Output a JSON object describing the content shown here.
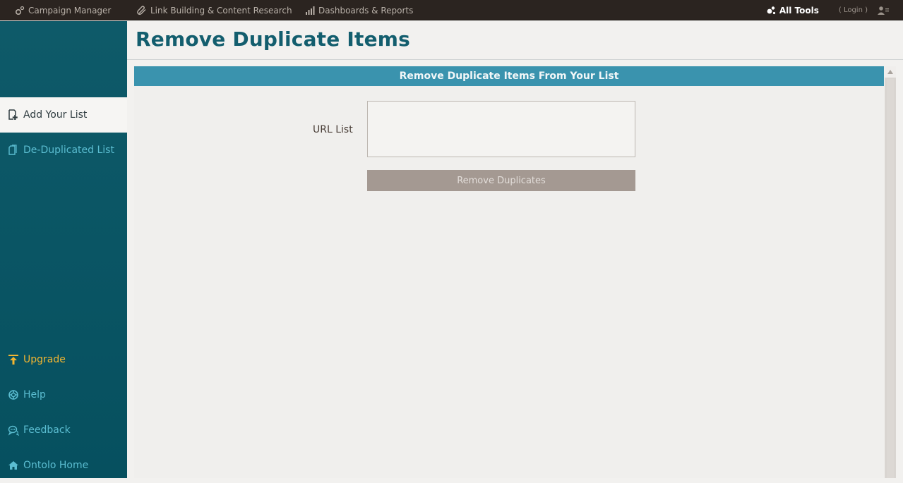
{
  "topnav": {
    "items": [
      {
        "label": "Campaign Manager",
        "icon": "gear-icon"
      },
      {
        "label": "Link Building & Content Research",
        "icon": "paperclip-icon"
      },
      {
        "label": "Dashboards & Reports",
        "icon": "bar-chart-icon"
      }
    ],
    "all_tools": "All Tools",
    "login": "( Login )"
  },
  "sidebar": {
    "items": [
      {
        "label": "Add Your List",
        "icon": "add-document-icon",
        "active": true
      },
      {
        "label": "De-Duplicated List",
        "icon": "document-icon"
      },
      {
        "label": "Upgrade",
        "icon": "upload-arrow-icon"
      },
      {
        "label": "Help",
        "icon": "lifebuoy-icon"
      },
      {
        "label": "Feedback",
        "icon": "chat-bubbles-icon"
      },
      {
        "label": "Ontolo Home",
        "icon": "home-icon"
      }
    ]
  },
  "main": {
    "title": "Remove Duplicate Items",
    "panel_header": "Remove Duplicate Items From Your List",
    "url_list_label": "URL List",
    "url_list_value": "",
    "remove_button": "Remove Duplicates"
  },
  "colors": {
    "topbar": "#2b2420",
    "sidebar": "#0b5766",
    "sidebar_link": "#5bbdd1",
    "upgrade": "#f2b531",
    "title": "#135e6e",
    "panel_header": "#3a93ae",
    "button": "#a49992"
  }
}
